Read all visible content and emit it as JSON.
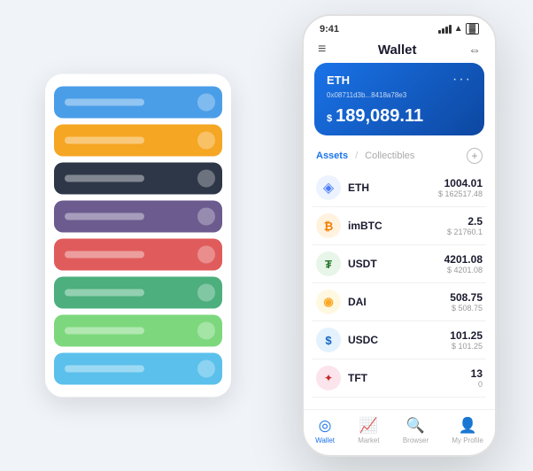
{
  "background": {
    "card_stack": {
      "cards": [
        {
          "color_class": "card-blue",
          "label": "Blue card"
        },
        {
          "color_class": "card-orange",
          "label": "Orange card"
        },
        {
          "color_class": "card-dark",
          "label": "Dark card"
        },
        {
          "color_class": "card-purple",
          "label": "Purple card"
        },
        {
          "color_class": "card-red",
          "label": "Red card"
        },
        {
          "color_class": "card-green",
          "label": "Green card"
        },
        {
          "color_class": "card-light-green",
          "label": "Light green card"
        },
        {
          "color_class": "card-sky",
          "label": "Sky blue card"
        }
      ]
    }
  },
  "phone": {
    "status_bar": {
      "time": "9:41",
      "icons": "signal wifi battery"
    },
    "nav": {
      "title": "Wallet",
      "menu_icon": "≡",
      "expand_icon": "⇔"
    },
    "eth_card": {
      "name": "ETH",
      "address": "0x08711d3b...8418a78e3",
      "dots": "···",
      "currency_symbol": "$",
      "balance": "189,089.11"
    },
    "assets_section": {
      "tab_active": "Assets",
      "tab_separator": "/",
      "tab_inactive": "Collectibles",
      "add_label": "+"
    },
    "assets": [
      {
        "symbol": "ETH",
        "icon": "◈",
        "icon_class": "icon-eth",
        "amount": "1004.01",
        "value": "$ 162517.48"
      },
      {
        "symbol": "imBTC",
        "icon": "₿",
        "icon_class": "icon-imbtc",
        "amount": "2.5",
        "value": "$ 21760.1"
      },
      {
        "symbol": "USDT",
        "icon": "₮",
        "icon_class": "icon-usdt",
        "amount": "4201.08",
        "value": "$ 4201.08"
      },
      {
        "symbol": "DAI",
        "icon": "◎",
        "icon_class": "icon-dai",
        "amount": "508.75",
        "value": "$ 508.75"
      },
      {
        "symbol": "USDC",
        "icon": "$",
        "icon_class": "icon-usdc",
        "amount": "101.25",
        "value": "$ 101.25"
      },
      {
        "symbol": "TFT",
        "icon": "✦",
        "icon_class": "icon-tft",
        "amount": "13",
        "value": "0"
      }
    ],
    "bottom_nav": [
      {
        "label": "Wallet",
        "icon": "◎",
        "active": true
      },
      {
        "label": "Market",
        "icon": "📊",
        "active": false
      },
      {
        "label": "Browser",
        "icon": "🌐",
        "active": false
      },
      {
        "label": "My Profile",
        "icon": "👤",
        "active": false
      }
    ]
  }
}
